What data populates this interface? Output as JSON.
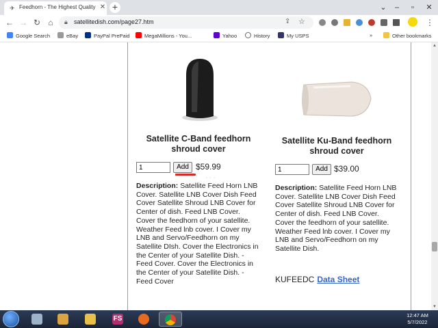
{
  "browser": {
    "tab_title": "Feedhorn - The Highest Quality S",
    "url": "satellitedish.com/page27.htm",
    "bookmarks": [
      "Google Search",
      "eBay",
      "PayPal PrePaid",
      "MegaMillions - You...",
      "Yahoo",
      "History",
      "My USPS"
    ],
    "bookmarks_more": "»",
    "other_bookmarks": "Other bookmarks"
  },
  "products": [
    {
      "title": "Satellite C-Band feedhorn shroud cover",
      "qty": "1",
      "add_label": "Add",
      "price": "$59.99",
      "desc_label": "Description:",
      "description": "Satellite Feed Horn LNB Cover. Satellite LNB Cover Dish Feed Cover Satellite Shroud LNB Cover for Center of dish. Feed LNB Cover. Cover the feedhorn of your satellite. Weather Feed lnb cover. I Cover my LNB and Servo/Feedhorn on my Satellite DIsh. Cover the Electronics in the Center of your Satellite Dish. - Feed Cover. Cover the Electronics in the Center of your Satellite Dish. - Feed Cover"
    },
    {
      "title": "Satellite Ku-Band  feedhorn shroud cover",
      "qty": "1",
      "add_label": "Add",
      "price": "$39.00",
      "desc_label": "Description:",
      "description": "Satellite Feed Horn LNB Cover. Satellite LNB Cover Dish Feed Cover Satellite Shroud LNB Cover for Center of dish. Feed LNB Cover. Cover the feedhorn of your satellite. Weather Feed lnb cover. I Cover my LNB and Servo/Feedhorn on my Satellite Dish.",
      "sku": "KUFEEDC",
      "datasheet_label": "Data Sheet"
    }
  ],
  "taskbar": {
    "app_fs_label": "FS",
    "time": "12:47 AM",
    "date": "5/7/2022"
  },
  "colors": {
    "link": "#3366cc",
    "underline_mark": "#d62828",
    "taskbar": "#1b2538"
  }
}
